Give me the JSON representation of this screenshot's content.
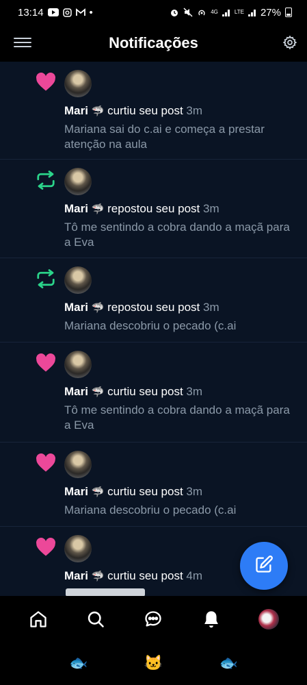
{
  "status_bar": {
    "time": "13:14",
    "dot": "•",
    "network_1": "4G",
    "network_2": "LTE",
    "battery": "27%"
  },
  "header": {
    "title": "Notificações"
  },
  "notifications": [
    {
      "type": "like",
      "name": "Mari",
      "emoji": "🦈",
      "action": "curtiu seu post",
      "time": "3m",
      "content": "Mariana sai do c.ai e começa a prestar atenção na aula"
    },
    {
      "type": "repost",
      "name": "Mari",
      "emoji": "🦈",
      "action": "repostou seu post",
      "time": "3m",
      "content": "Tô me sentindo a cobra dando a maçã para a Eva"
    },
    {
      "type": "repost",
      "name": "Mari",
      "emoji": "🦈",
      "action": "repostou seu post",
      "time": "3m",
      "content": "Mariana descobriu o pecado (c.ai"
    },
    {
      "type": "like",
      "name": "Mari",
      "emoji": "🦈",
      "action": "curtiu seu post",
      "time": "3m",
      "content": "Tô me sentindo a cobra dando a maçã para a Eva"
    },
    {
      "type": "like",
      "name": "Mari",
      "emoji": "🦈",
      "action": "curtiu seu post",
      "time": "3m",
      "content": "Mariana descobriu o pecado (c.ai"
    },
    {
      "type": "like",
      "name": "Mari",
      "emoji": "🦈",
      "action": "curtiu seu post",
      "time": "4m",
      "content": ""
    }
  ],
  "colors": {
    "like": "#ec4899",
    "repost": "#2bd48a",
    "accent": "#2d7cf6",
    "background": "#0a1424"
  },
  "icons": {
    "menu": "menu-icon",
    "settings": "gear-icon",
    "compose": "compose-icon",
    "home": "home-icon",
    "search": "search-icon",
    "chat": "chat-icon",
    "notifications": "bell-icon"
  },
  "sys_nav": {
    "left": "🐟",
    "center": "🐱",
    "right": "🐟"
  }
}
